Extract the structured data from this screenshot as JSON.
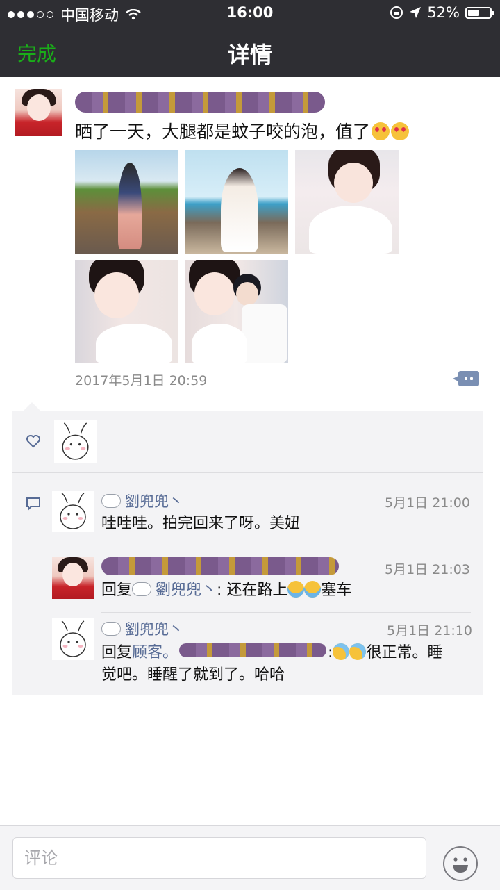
{
  "status_bar": {
    "carrier": "中国移动",
    "time": "16:00",
    "battery": "52%",
    "battery_level": 0.52
  },
  "nav": {
    "done_label": "完成",
    "title": "详情"
  },
  "post": {
    "text": "晒了一天，大腿都是蚊子咬的泡，值了",
    "photos": [
      "photo-1",
      "photo-2",
      "photo-3",
      "photo-4",
      "photo-5"
    ],
    "timestamp": "2017年5月1日 20:59"
  },
  "comments": [
    {
      "name": "劉兜兜丶",
      "time": "5月1日 21:00",
      "text": "哇哇哇。拍完回来了呀。美妞"
    },
    {
      "time": "5月1日 21:03",
      "reply_prefix": "回复",
      "reply_to": "劉兜兜丶",
      "text_a": ": 还在路上",
      "text_b": "塞车"
    },
    {
      "name": "劉兜兜丶",
      "time": "5月1日 21:10",
      "reply_prefix": "回复",
      "reply_to": "顾客。",
      "text_a": ":",
      "text_b": "很正常。睡",
      "text_c": "觉吧。睡醒了就到了。哈哈"
    }
  ],
  "comment_bar": {
    "placeholder": "评论"
  },
  "icons": {
    "heart": "heart-icon",
    "comment": "comment-icon",
    "more": "more-dots-icon",
    "emoji": "smiley-icon"
  },
  "colors": {
    "nav_bg": "#2e2e33",
    "accent_green": "#1aad19",
    "link_blue": "#576b95"
  }
}
